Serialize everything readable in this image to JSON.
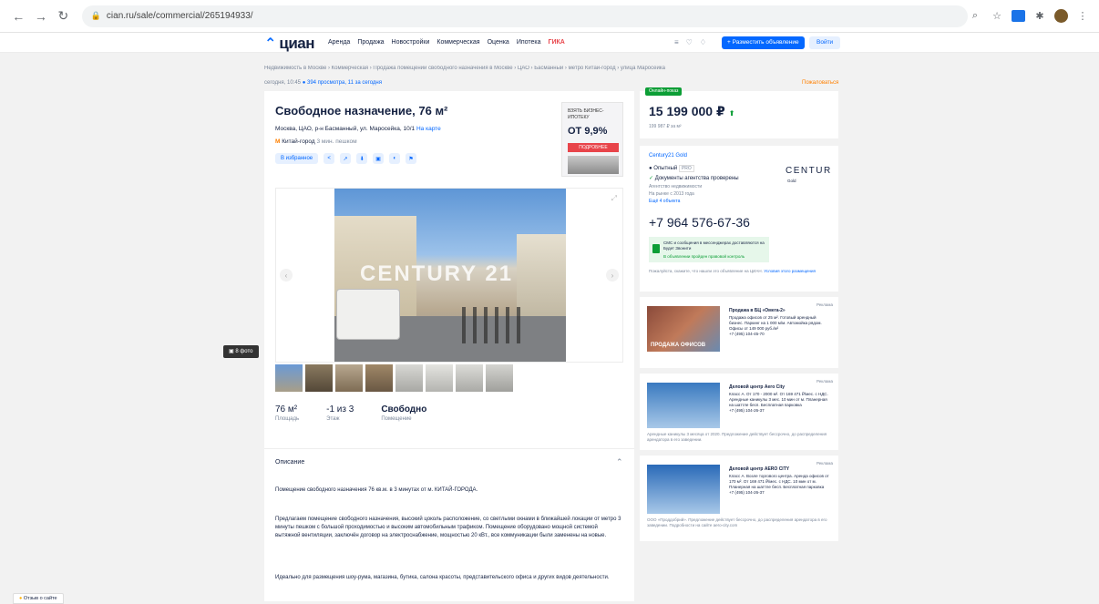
{
  "browser": {
    "url": "cian.ru/sale/commercial/265194933/"
  },
  "header": {
    "logo": "циан",
    "nav": [
      "Аренда",
      "Продажа",
      "Новостройки",
      "Коммерческая",
      "Оценка",
      "Ипотека"
    ],
    "nav_extra": "ГИКА",
    "place_button": "+ Разместить объявление",
    "login_button": "Войти"
  },
  "breadcrumbs": "Недвижимость в Москве › Коммерческая › Продажа помещений свободного назначения в Москве › ЦАО › Басманный › метро Китай-город › улица Маросейка",
  "meta": {
    "date": "сегодня, 10:45",
    "views": "394 просмотра, 11 за сегодня",
    "complain": "Пожаловаться"
  },
  "listing": {
    "title": "Свободное назначение, 76 м²",
    "address": "Москва, ЦАО, р-н Басманный, ул. Маросейка, 10/1",
    "map_link": "На карте",
    "metro": "Китай-город",
    "metro_walk": "3 мин. пешком",
    "favorite_button": "В избранное",
    "photo_count_button": "8 фото",
    "watermark": "CENTURY 21"
  },
  "promo": {
    "line1": "ВЗЯТЬ БИЗНЕС-ИПОТЕКУ",
    "rate": "ОТ 9,9%",
    "button": "ПОДРОБНЕЕ"
  },
  "specs": [
    {
      "value": "76 м²",
      "label": "Площадь"
    },
    {
      "value": "-1 из 3",
      "label": "Этаж"
    },
    {
      "value": "Свободно",
      "label": "Помещение"
    }
  ],
  "description": {
    "title": "Описание",
    "p1": "Помещение свободного назначения 76 кв.м. в 3 минутах от м. КИТАЙ-ГОРОДА.",
    "p2": "Предлагаем помещение свободного назначения, высокий цоколь расположение, со светлыми окнами в ближайшей локации от метро 3 минуты пешком с большой проходимостью и высоким автомобильным трафиком. Помещение оборудовано мощной системой вытяжной вентиляции, заключён договор на электроснабжение, мощностью 20 кВт., все коммуникации были заменены на новые.",
    "p3": "Идеально для размещения шоу-рума, магазина, бутика, салона красоты, представительского офиса и других видов деятельности."
  },
  "price": {
    "badge": "Онлайн-показ",
    "value": "15 199 000 ₽",
    "per_meter": "199 987 ₽ за м²"
  },
  "agent": {
    "agency": "Century21 Gold",
    "type": "Опытный",
    "type_badge": "PRO",
    "docs": "Документы агентства проверены",
    "sub1": "Агентство недвижимости",
    "sub2": "На рынке с 2013 года",
    "more": "Ещё 4 объекта",
    "logo_text": "CENTUR",
    "logo_sub": "Gold",
    "phone": "+7 964 576-67-36",
    "sms_text": "СМС и сообщения в мессенджерах доставляются на Будет Звонити",
    "sms_sub": "В объявлении пройден правовой контроль",
    "note": "Пожалуйста, скажите, что нашли это объявление на ЦИАН.",
    "note_link": "Условия этого размещения"
  },
  "ads": [
    {
      "tag": "Реклама",
      "image_label": "ПРОДАЖА ОФИСОВ",
      "title": "Продажа в БЦ «Омега-2»",
      "text": "Продажа офисов от 25 м². Готовый арендный бизнес. Паркинг на 1 000 м/м. Автомойка рядом. Офисы от 149 000 руб./м²",
      "phone": "+7 (495) 104-45-70",
      "legal": ""
    },
    {
      "tag": "Реклама",
      "image_label": "",
      "title": "Деловой центр Aero City",
      "text": "Класс А. От 170 - 2000 м². От 169 471 ₽/мес. с НДС. Арендные каникулы 3 мес. 10 мин от м. Планерная на шаттле бесп. Бесплатная парковка",
      "phone": "+7 (495) 104-26-37",
      "legal": "Арендные каникулы 3 месяца от 2020. Предложение действует бессрочно, до распределения арендатора в его заведении."
    },
    {
      "tag": "Реклама",
      "image_label": "",
      "title": "Деловой центр AERO CITY",
      "text": "Класс А. Возле торгового центра. Аренда офисов от 170 м². От 169 471 ₽/мес. с НДС. 10 мин от м. Планерная на шаттле бесп. Бесплатная парковка",
      "phone": "+7 (495) 104-26-37",
      "legal": "ООО «Проддобрий». Предложение действует бессрочно, до распределения арендатора в его заведении. Подробности на сайте aero-city.com"
    }
  ],
  "feedback": "Отзыв о сайте",
  "colors": {
    "brand_blue": "#0468ff",
    "green": "#0c9e36",
    "text": "#152242",
    "muted": "#7a8699",
    "red": "#e8444a"
  }
}
